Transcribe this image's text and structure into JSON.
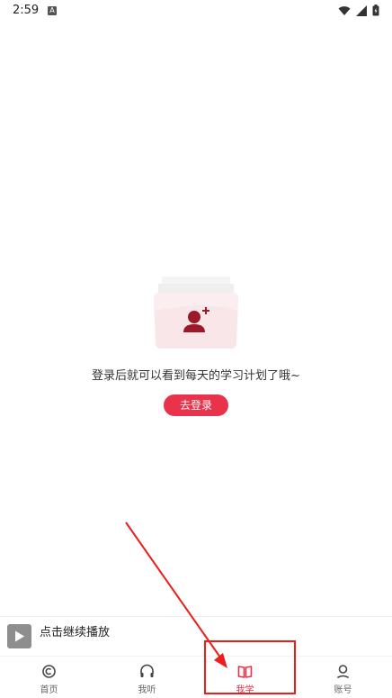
{
  "status_bar": {
    "time": "2:59",
    "notification_icon": "a-icon",
    "icons": [
      "wifi-icon",
      "signal-icon",
      "battery-icon"
    ]
  },
  "empty_state": {
    "illustration": "add-user-folder-icon",
    "message": "登录后就可以看到每天的学习计划了哦~",
    "login_button": "去登录"
  },
  "mini_player": {
    "title": "点击继续播放",
    "cover_icon": "play-icon"
  },
  "tab_bar": {
    "tabs": [
      {
        "label": "首页",
        "icon": "home-icon",
        "active": false
      },
      {
        "label": "我听",
        "icon": "headphones-icon",
        "active": false
      },
      {
        "label": "我学",
        "icon": "book-icon",
        "active": true
      },
      {
        "label": "账号",
        "icon": "account-icon",
        "active": false
      }
    ]
  },
  "colors": {
    "accent": "#e8334a",
    "annotation": "#ef1c1c"
  }
}
